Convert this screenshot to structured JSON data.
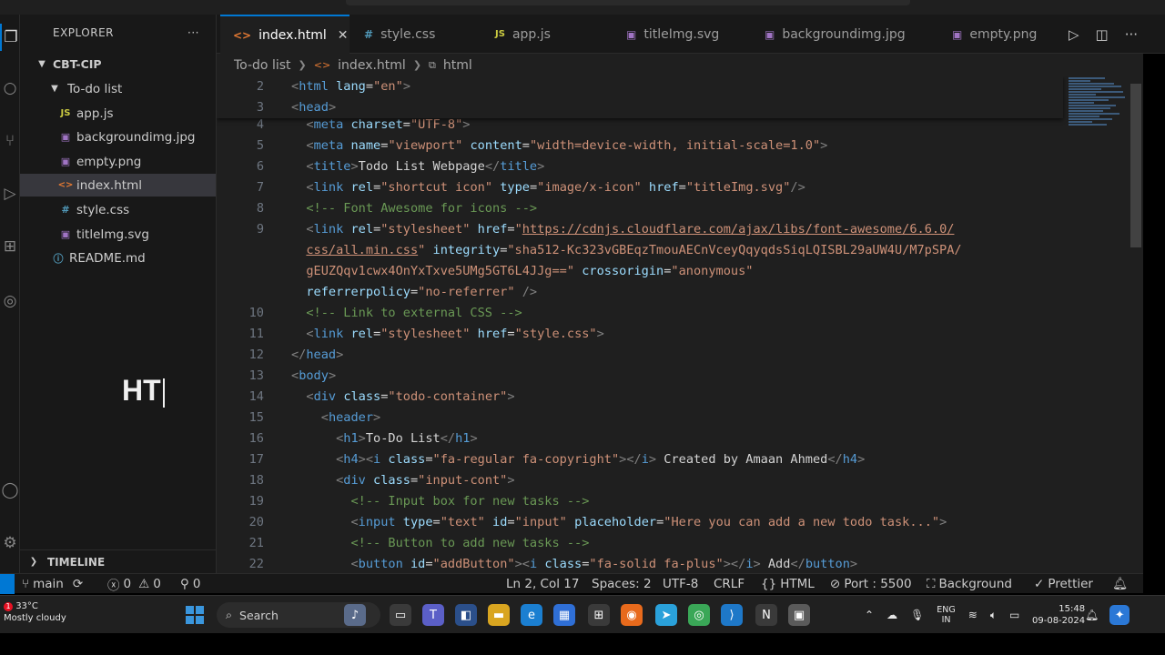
{
  "sidebar": {
    "title": "EXPLORER",
    "more_label": "···",
    "workspace": "CBT-CIP",
    "folder": "To-do list",
    "files": [
      {
        "name": "app.js",
        "icon": "JS"
      },
      {
        "name": "backgroundimg.jpg",
        "icon": "▣"
      },
      {
        "name": "empty.png",
        "icon": "▣"
      },
      {
        "name": "index.html",
        "icon": "<>"
      },
      {
        "name": "style.css",
        "icon": "#"
      },
      {
        "name": "titleImg.svg",
        "icon": "▣"
      }
    ],
    "readme": "README.md",
    "overlay_text": "HT",
    "timeline": "TIMELINE"
  },
  "tabs": [
    {
      "label": "index.html",
      "icon": "<>"
    },
    {
      "label": "style.css",
      "icon": "#"
    },
    {
      "label": "app.js",
      "icon": "JS"
    },
    {
      "label": "titleImg.svg",
      "icon": "▣"
    },
    {
      "label": "backgroundimg.jpg",
      "icon": "▣"
    },
    {
      "label": "empty.png",
      "icon": "▣"
    }
  ],
  "breadcrumb": [
    "To-do list",
    "index.html",
    "html"
  ],
  "code": {
    "l2": "2",
    "l2_tag": "html",
    "l2_attr": "lang",
    "l2_val": "\"en\"",
    "l3": "3",
    "l3_tag": "head",
    "l4": "4",
    "l4_attr": "charset",
    "l4_val": "\"UTF-8\"",
    "l5": "5",
    "l5_attr1": "name",
    "l5_val1": "\"viewport\"",
    "l5_attr2": "content",
    "l5_val2": "\"width=device-width, initial-scale=1.0\"",
    "l6": "6",
    "l6_text": "Todo List Webpage",
    "l7": "7",
    "l7_attr1": "rel",
    "l7_val1": "\"shortcut icon\"",
    "l7_attr2": "type",
    "l7_val2": "\"image/x-icon\"",
    "l7_attr3": "href",
    "l7_val3": "\"titleImg.svg\"",
    "l8": "8",
    "l8_comment": "<!-- Font Awesome for icons -->",
    "l9": "9",
    "l9_val1": "\"stylesheet\"",
    "l9_url": "https://cdnjs.cloudflare.com/ajax/libs/font-awesome/6.6.0/",
    "l9_url2": "css/all.min.css",
    "l9_attr3": "integrity",
    "l9_val3": "\"sha512-Kc323vGBEqzTmouAECnVceyQqyqdsSiqLQISBL29aUW4U/M7pSPA/",
    "l9_val3b": "gEUZQqv1cwx4OnYxTxve5UMg5GT6L4JJg==\"",
    "l9_attr4": "crossorigin",
    "l9_val4": "\"anonymous\"",
    "l9_attr5": "referrerpolicy",
    "l9_val5": "\"no-referrer\"",
    "l10": "10",
    "l10_comment": "<!-- Link to external CSS -->",
    "l11": "11",
    "l11_val1": "\"stylesheet\"",
    "l11_val2": "\"style.css\"",
    "l12": "12",
    "l13": "13",
    "l14": "14",
    "l14_val": "\"todo-container\"",
    "l15": "15",
    "l16": "16",
    "l16_text": "To-Do List",
    "l17": "17",
    "l17_val": "\"fa-regular fa-copyright\"",
    "l17_text": " Created by Amaan Ahmed",
    "l18": "18",
    "l18_val": "\"input-cont\"",
    "l19": "19",
    "l19_comment": "<!-- Input box for new tasks -->",
    "l20": "20",
    "l20_val1": "\"text\"",
    "l20_val2": "\"input\"",
    "l20_val3": "\"Here you can add a new todo task...\"",
    "l21": "21",
    "l21_comment": "<!-- Button to add new tasks -->",
    "l22": "22",
    "l22_val1": "\"addButton\"",
    "l22_val2": "\"fa-solid fa-plus\"",
    "l22_text": " Add"
  },
  "statusbar": {
    "branch": "main",
    "errors": "0",
    "warnings": "0",
    "ports": "0",
    "position": "Ln 2, Col 17",
    "spaces": "Spaces: 2",
    "encoding": "UTF-8",
    "eol": "CRLF",
    "language": "HTML",
    "port": "Port : 5500",
    "background": "Background",
    "prettier": "Prettier"
  },
  "taskbar": {
    "weather_badge": "1",
    "temperature": "33°C",
    "condition": "Mostly cloudy",
    "search": "Search",
    "lang1": "ENG",
    "lang2": "IN",
    "time": "15:48",
    "date": "09-08-2024"
  }
}
